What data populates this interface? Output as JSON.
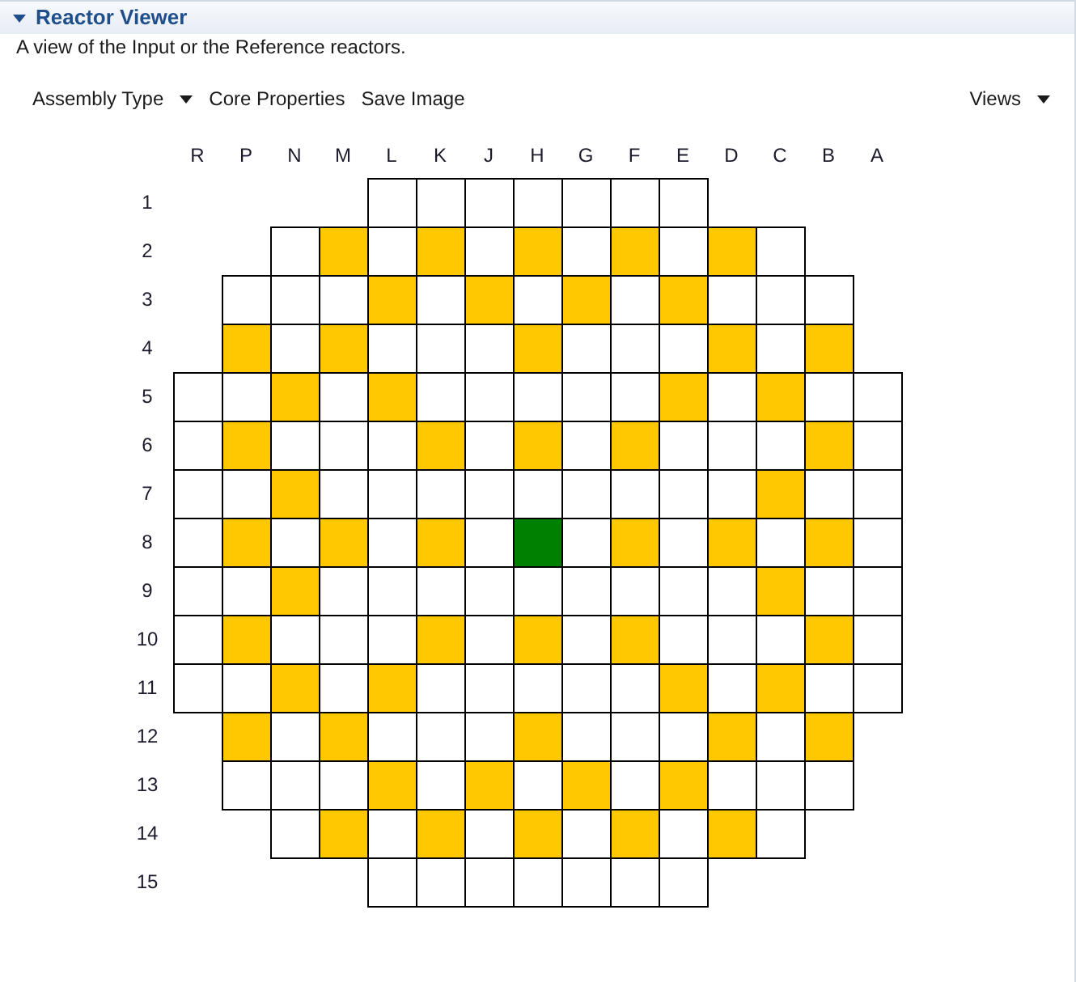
{
  "section": {
    "title": "Reactor Viewer",
    "expanded": true
  },
  "description": "A view of the Input or the Reference reactors.",
  "toolbar": {
    "items": [
      {
        "label": "Assembly Type",
        "kind": "dropdown"
      },
      {
        "label": "Core Properties",
        "kind": "button"
      },
      {
        "label": "Save Image",
        "kind": "button"
      }
    ],
    "right_items": [
      {
        "label": "Views",
        "kind": "dropdown"
      }
    ]
  },
  "grid": {
    "columns": [
      "R",
      "P",
      "N",
      "M",
      "L",
      "K",
      "J",
      "H",
      "G",
      "F",
      "E",
      "D",
      "C",
      "B",
      "A"
    ],
    "rows": [
      {
        "label": "1",
        "cells": [
          null,
          null,
          null,
          null,
          {
            "color": "#ffffff"
          },
          {
            "color": "#ffffff"
          },
          {
            "color": "#ffffff"
          },
          {
            "color": "#ffffff"
          },
          {
            "color": "#ffffff"
          },
          {
            "color": "#ffffff"
          },
          {
            "color": "#ffffff"
          },
          null,
          null,
          null,
          null
        ]
      },
      {
        "label": "2",
        "cells": [
          null,
          null,
          {
            "color": "#ffffff"
          },
          {
            "color": "#ffc800"
          },
          {
            "color": "#ffffff"
          },
          {
            "color": "#ffc800"
          },
          {
            "color": "#ffffff"
          },
          {
            "color": "#ffc800"
          },
          {
            "color": "#ffffff"
          },
          {
            "color": "#ffc800"
          },
          {
            "color": "#ffffff"
          },
          {
            "color": "#ffc800"
          },
          {
            "color": "#ffffff"
          },
          null,
          null
        ]
      },
      {
        "label": "3",
        "cells": [
          null,
          {
            "color": "#ffffff"
          },
          {
            "color": "#ffffff"
          },
          {
            "color": "#ffffff"
          },
          {
            "color": "#ffc800"
          },
          {
            "color": "#ffffff"
          },
          {
            "color": "#ffc800"
          },
          {
            "color": "#ffffff"
          },
          {
            "color": "#ffc800"
          },
          {
            "color": "#ffffff"
          },
          {
            "color": "#ffc800"
          },
          {
            "color": "#ffffff"
          },
          {
            "color": "#ffffff"
          },
          {
            "color": "#ffffff"
          },
          null
        ]
      },
      {
        "label": "4",
        "cells": [
          null,
          {
            "color": "#ffc800"
          },
          {
            "color": "#ffffff"
          },
          {
            "color": "#ffc800"
          },
          {
            "color": "#ffffff"
          },
          {
            "color": "#ffffff"
          },
          {
            "color": "#ffffff"
          },
          {
            "color": "#ffc800"
          },
          {
            "color": "#ffffff"
          },
          {
            "color": "#ffffff"
          },
          {
            "color": "#ffffff"
          },
          {
            "color": "#ffc800"
          },
          {
            "color": "#ffffff"
          },
          {
            "color": "#ffc800"
          },
          null
        ]
      },
      {
        "label": "5",
        "cells": [
          {
            "color": "#ffffff"
          },
          {
            "color": "#ffffff"
          },
          {
            "color": "#ffc800"
          },
          {
            "color": "#ffffff"
          },
          {
            "color": "#ffc800"
          },
          {
            "color": "#ffffff"
          },
          {
            "color": "#ffffff"
          },
          {
            "color": "#ffffff"
          },
          {
            "color": "#ffffff"
          },
          {
            "color": "#ffffff"
          },
          {
            "color": "#ffc800"
          },
          {
            "color": "#ffffff"
          },
          {
            "color": "#ffc800"
          },
          {
            "color": "#ffffff"
          },
          {
            "color": "#ffffff"
          }
        ]
      },
      {
        "label": "6",
        "cells": [
          {
            "color": "#ffffff"
          },
          {
            "color": "#ffc800"
          },
          {
            "color": "#ffffff"
          },
          {
            "color": "#ffffff"
          },
          {
            "color": "#ffffff"
          },
          {
            "color": "#ffc800"
          },
          {
            "color": "#ffffff"
          },
          {
            "color": "#ffc800"
          },
          {
            "color": "#ffffff"
          },
          {
            "color": "#ffc800"
          },
          {
            "color": "#ffffff"
          },
          {
            "color": "#ffffff"
          },
          {
            "color": "#ffffff"
          },
          {
            "color": "#ffc800"
          },
          {
            "color": "#ffffff"
          }
        ]
      },
      {
        "label": "7",
        "cells": [
          {
            "color": "#ffffff"
          },
          {
            "color": "#ffffff"
          },
          {
            "color": "#ffc800"
          },
          {
            "color": "#ffffff"
          },
          {
            "color": "#ffffff"
          },
          {
            "color": "#ffffff"
          },
          {
            "color": "#ffffff"
          },
          {
            "color": "#ffffff"
          },
          {
            "color": "#ffffff"
          },
          {
            "color": "#ffffff"
          },
          {
            "color": "#ffffff"
          },
          {
            "color": "#ffffff"
          },
          {
            "color": "#ffc800"
          },
          {
            "color": "#ffffff"
          },
          {
            "color": "#ffffff"
          }
        ]
      },
      {
        "label": "8",
        "cells": [
          {
            "color": "#ffffff"
          },
          {
            "color": "#ffc800"
          },
          {
            "color": "#ffffff"
          },
          {
            "color": "#ffc800"
          },
          {
            "color": "#ffffff"
          },
          {
            "color": "#ffc800"
          },
          {
            "color": "#ffffff"
          },
          {
            "color": "#008000"
          },
          {
            "color": "#ffffff"
          },
          {
            "color": "#ffc800"
          },
          {
            "color": "#ffffff"
          },
          {
            "color": "#ffc800"
          },
          {
            "color": "#ffffff"
          },
          {
            "color": "#ffc800"
          },
          {
            "color": "#ffffff"
          }
        ]
      },
      {
        "label": "9",
        "cells": [
          {
            "color": "#ffffff"
          },
          {
            "color": "#ffffff"
          },
          {
            "color": "#ffc800"
          },
          {
            "color": "#ffffff"
          },
          {
            "color": "#ffffff"
          },
          {
            "color": "#ffffff"
          },
          {
            "color": "#ffffff"
          },
          {
            "color": "#ffffff"
          },
          {
            "color": "#ffffff"
          },
          {
            "color": "#ffffff"
          },
          {
            "color": "#ffffff"
          },
          {
            "color": "#ffffff"
          },
          {
            "color": "#ffc800"
          },
          {
            "color": "#ffffff"
          },
          {
            "color": "#ffffff"
          }
        ]
      },
      {
        "label": "10",
        "cells": [
          {
            "color": "#ffffff"
          },
          {
            "color": "#ffc800"
          },
          {
            "color": "#ffffff"
          },
          {
            "color": "#ffffff"
          },
          {
            "color": "#ffffff"
          },
          {
            "color": "#ffc800"
          },
          {
            "color": "#ffffff"
          },
          {
            "color": "#ffc800"
          },
          {
            "color": "#ffffff"
          },
          {
            "color": "#ffc800"
          },
          {
            "color": "#ffffff"
          },
          {
            "color": "#ffffff"
          },
          {
            "color": "#ffffff"
          },
          {
            "color": "#ffc800"
          },
          {
            "color": "#ffffff"
          }
        ]
      },
      {
        "label": "11",
        "cells": [
          {
            "color": "#ffffff"
          },
          {
            "color": "#ffffff"
          },
          {
            "color": "#ffc800"
          },
          {
            "color": "#ffffff"
          },
          {
            "color": "#ffc800"
          },
          {
            "color": "#ffffff"
          },
          {
            "color": "#ffffff"
          },
          {
            "color": "#ffffff"
          },
          {
            "color": "#ffffff"
          },
          {
            "color": "#ffffff"
          },
          {
            "color": "#ffc800"
          },
          {
            "color": "#ffffff"
          },
          {
            "color": "#ffc800"
          },
          {
            "color": "#ffffff"
          },
          {
            "color": "#ffffff"
          }
        ]
      },
      {
        "label": "12",
        "cells": [
          null,
          {
            "color": "#ffc800"
          },
          {
            "color": "#ffffff"
          },
          {
            "color": "#ffc800"
          },
          {
            "color": "#ffffff"
          },
          {
            "color": "#ffffff"
          },
          {
            "color": "#ffffff"
          },
          {
            "color": "#ffc800"
          },
          {
            "color": "#ffffff"
          },
          {
            "color": "#ffffff"
          },
          {
            "color": "#ffffff"
          },
          {
            "color": "#ffc800"
          },
          {
            "color": "#ffffff"
          },
          {
            "color": "#ffc800"
          },
          null
        ]
      },
      {
        "label": "13",
        "cells": [
          null,
          {
            "color": "#ffffff"
          },
          {
            "color": "#ffffff"
          },
          {
            "color": "#ffffff"
          },
          {
            "color": "#ffc800"
          },
          {
            "color": "#ffffff"
          },
          {
            "color": "#ffc800"
          },
          {
            "color": "#ffffff"
          },
          {
            "color": "#ffc800"
          },
          {
            "color": "#ffffff"
          },
          {
            "color": "#ffc800"
          },
          {
            "color": "#ffffff"
          },
          {
            "color": "#ffffff"
          },
          {
            "color": "#ffffff"
          },
          null
        ]
      },
      {
        "label": "14",
        "cells": [
          null,
          null,
          {
            "color": "#ffffff"
          },
          {
            "color": "#ffc800"
          },
          {
            "color": "#ffffff"
          },
          {
            "color": "#ffc800"
          },
          {
            "color": "#ffffff"
          },
          {
            "color": "#ffc800"
          },
          {
            "color": "#ffffff"
          },
          {
            "color": "#ffc800"
          },
          {
            "color": "#ffffff"
          },
          {
            "color": "#ffc800"
          },
          {
            "color": "#ffffff"
          },
          null,
          null
        ]
      },
      {
        "label": "15",
        "cells": [
          null,
          null,
          null,
          null,
          {
            "color": "#ffffff"
          },
          {
            "color": "#ffffff"
          },
          {
            "color": "#ffffff"
          },
          {
            "color": "#ffffff"
          },
          {
            "color": "#ffffff"
          },
          {
            "color": "#ffffff"
          },
          {
            "color": "#ffffff"
          },
          null,
          null,
          null,
          null
        ]
      }
    ]
  }
}
